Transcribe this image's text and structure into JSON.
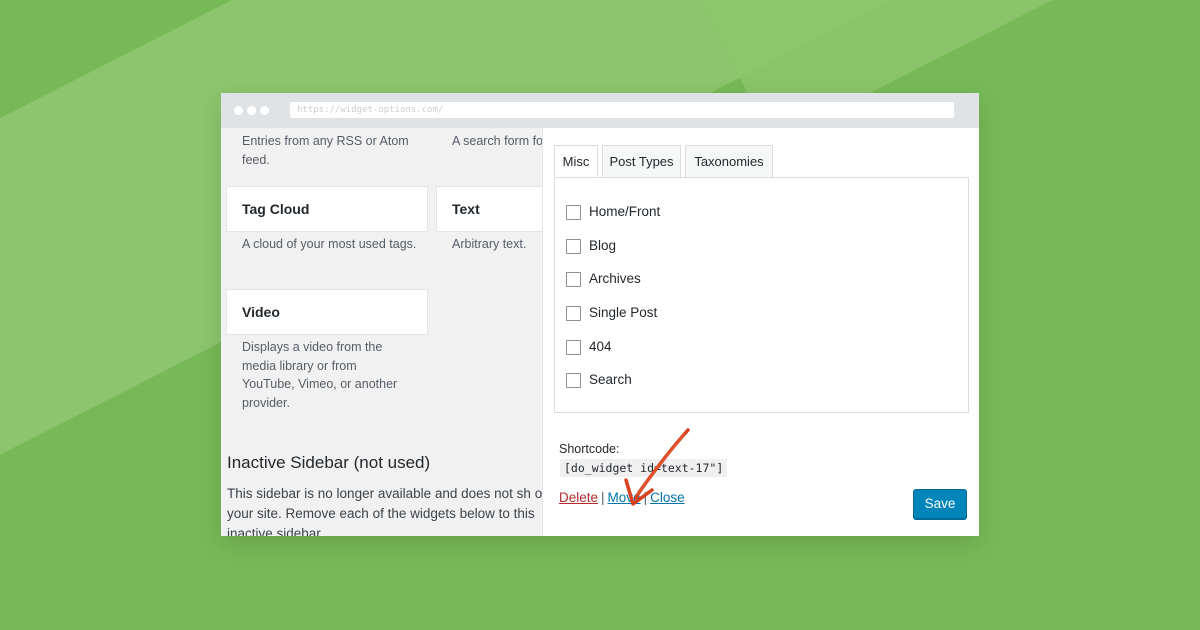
{
  "browser": {
    "url": "https://widget-options.com/"
  },
  "widgets": {
    "rss_desc": "Entries from any RSS or Atom feed.",
    "search_desc": "A search form fo",
    "tag_cloud": {
      "title": "Tag Cloud",
      "desc": "A cloud of your most used tags."
    },
    "text": {
      "title": "Text",
      "desc": "Arbitrary text."
    },
    "video": {
      "title": "Video",
      "desc": "Displays a video from the media library or from YouTube, Vimeo, or another provider."
    }
  },
  "inactive": {
    "title": "Inactive Sidebar (not used)",
    "text": "This sidebar is no longer available and does not sh on your site. Remove each of the widgets below to this inactive sidebar."
  },
  "options_panel": {
    "tabs": [
      {
        "label": "Misc",
        "active": true
      },
      {
        "label": "Post Types",
        "active": false
      },
      {
        "label": "Taxonomies",
        "active": false
      }
    ],
    "checkboxes": [
      {
        "label": "Home/Front",
        "checked": false
      },
      {
        "label": "Blog",
        "checked": false
      },
      {
        "label": "Archives",
        "checked": false
      },
      {
        "label": "Single Post",
        "checked": false
      },
      {
        "label": "404",
        "checked": false
      },
      {
        "label": "Search",
        "checked": false
      }
    ],
    "shortcode_label": "Shortcode:",
    "shortcode_value": "[do_widget id=text-17\"]",
    "actions": {
      "delete": "Delete",
      "move": "Move",
      "close": "Close",
      "separator": "|"
    },
    "save_label": "Save"
  },
  "colors": {
    "background": "#77b957",
    "delete_link": "#b32d2e",
    "link": "#0073aa",
    "save_button": "#0085ba",
    "annotation_arrow": "#d9411e"
  }
}
